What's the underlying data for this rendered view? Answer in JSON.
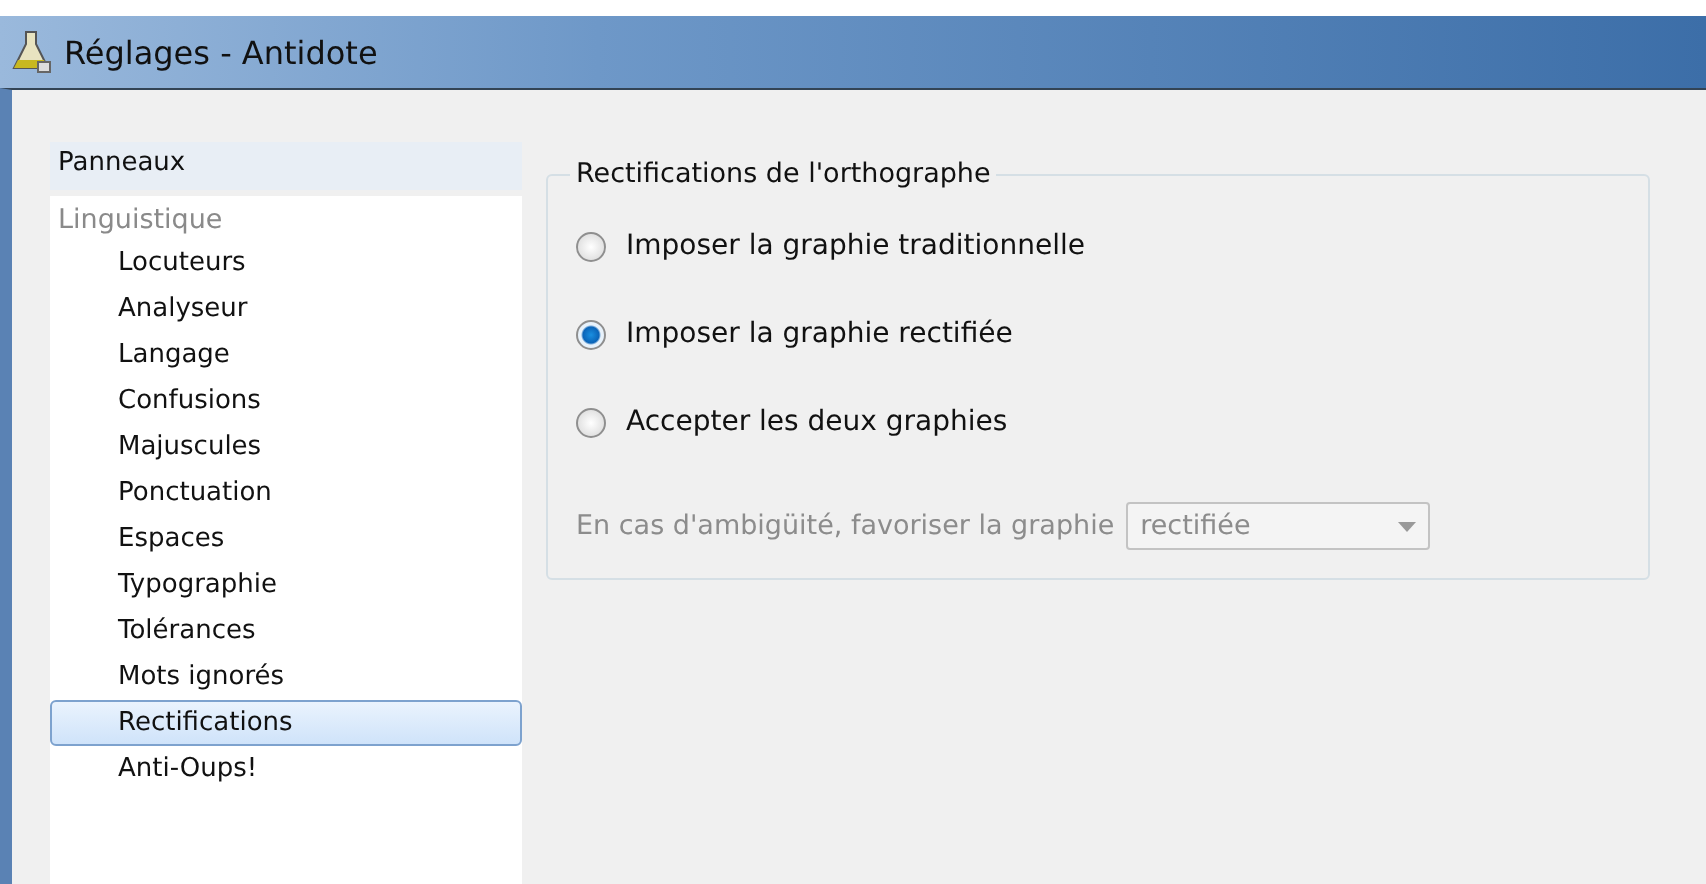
{
  "window": {
    "title": "Réglages - Antidote"
  },
  "sidebar": {
    "header": "Panneaux",
    "items": [
      {
        "label": "Linguistique",
        "selected": false,
        "children": [
          {
            "label": "Locuteurs",
            "selected": false
          },
          {
            "label": "Analyseur",
            "selected": false
          },
          {
            "label": "Langage",
            "selected": false
          },
          {
            "label": "Confusions",
            "selected": false
          },
          {
            "label": "Majuscules",
            "selected": false
          },
          {
            "label": "Ponctuation",
            "selected": false
          },
          {
            "label": "Espaces",
            "selected": false
          },
          {
            "label": "Typographie",
            "selected": false
          },
          {
            "label": "Tolérances",
            "selected": false
          },
          {
            "label": "Mots ignorés",
            "selected": false
          },
          {
            "label": "Rectifications",
            "selected": true
          },
          {
            "label": "Anti-Oups!",
            "selected": false
          }
        ]
      }
    ]
  },
  "group": {
    "title": "Rectifications de l'orthographe",
    "options": [
      {
        "label": "Imposer la graphie traditionnelle",
        "selected": false
      },
      {
        "label": "Imposer la graphie rectifiée",
        "selected": true
      },
      {
        "label": "Accepter les deux graphies",
        "selected": false
      }
    ],
    "ambiguity": {
      "label": "En cas d'ambigüité, favoriser la graphie",
      "value": "rectifiée",
      "disabled": true
    }
  }
}
